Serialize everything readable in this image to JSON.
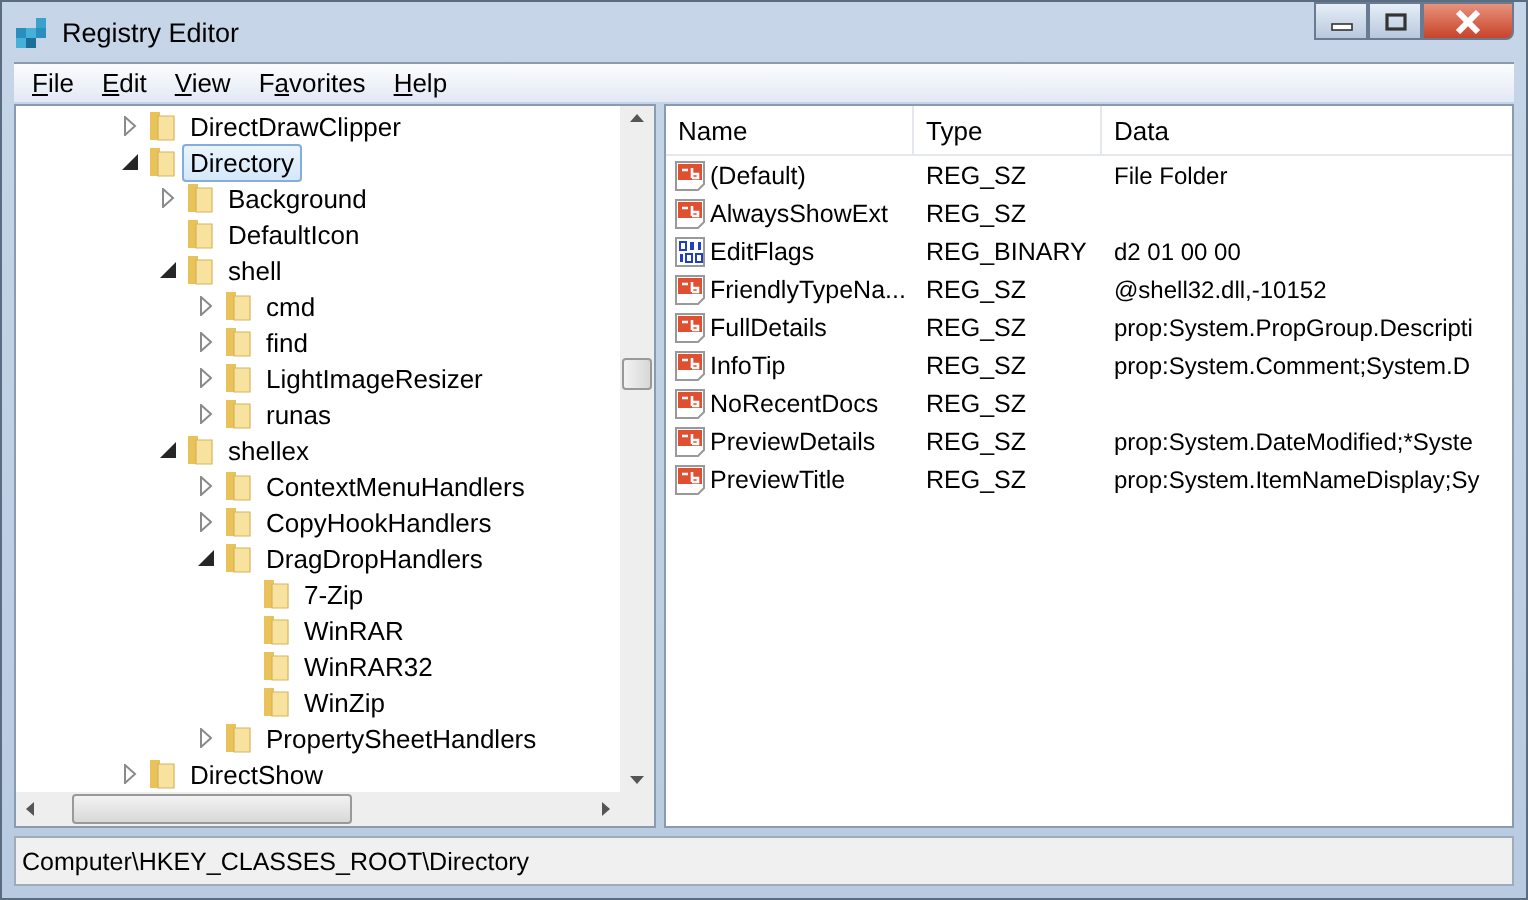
{
  "window": {
    "title": "Registry Editor"
  },
  "menu": [
    "File",
    "Edit",
    "View",
    "Favorites",
    "Help"
  ],
  "tree": [
    {
      "label": "DirectDrawClipper",
      "expanded": false,
      "selected": false
    },
    {
      "label": "Directory",
      "expanded": true,
      "selected": true,
      "children": [
        {
          "label": "Background",
          "expanded": false,
          "selected": false
        },
        {
          "label": "DefaultIcon",
          "selected": false
        },
        {
          "label": "shell",
          "expanded": true,
          "selected": false,
          "children": [
            {
              "label": "cmd",
              "expanded": false,
              "selected": false
            },
            {
              "label": "find",
              "expanded": false,
              "selected": false
            },
            {
              "label": "LightImageResizer",
              "expanded": false,
              "selected": false
            },
            {
              "label": "runas",
              "expanded": false,
              "selected": false
            }
          ]
        },
        {
          "label": "shellex",
          "expanded": true,
          "selected": false,
          "children": [
            {
              "label": "ContextMenuHandlers",
              "expanded": false,
              "selected": false
            },
            {
              "label": "CopyHookHandlers",
              "expanded": false,
              "selected": false
            },
            {
              "label": "DragDropHandlers",
              "expanded": true,
              "selected": false,
              "children": [
                {
                  "label": "7-Zip",
                  "selected": false
                },
                {
                  "label": "WinRAR",
                  "selected": false
                },
                {
                  "label": "WinRAR32",
                  "selected": false
                },
                {
                  "label": "WinZip",
                  "selected": false
                }
              ]
            },
            {
              "label": "PropertySheetHandlers",
              "expanded": false,
              "selected": false
            }
          ]
        }
      ]
    },
    {
      "label": "DirectShow",
      "expanded": false,
      "selected": false
    }
  ],
  "table": {
    "columns": [
      "Name",
      "Type",
      "Data"
    ],
    "rows": [
      {
        "kind": "string",
        "name": "(Default)",
        "type": "REG_SZ",
        "data": "File Folder"
      },
      {
        "kind": "string",
        "name": "AlwaysShowExt",
        "type": "REG_SZ"
      },
      {
        "kind": "binary",
        "name": "EditFlags",
        "type": "REG_BINARY",
        "data": "d2 01 00 00"
      },
      {
        "kind": "string",
        "name": "FriendlyTypeNa...",
        "type": "REG_SZ",
        "data": "@shell32.dll,-10152"
      },
      {
        "kind": "string",
        "name": "FullDetails",
        "type": "REG_SZ",
        "data": "prop:System.PropGroup.Descripti"
      },
      {
        "kind": "string",
        "name": "InfoTip",
        "type": "REG_SZ",
        "data": "prop:System.Comment;System.D"
      },
      {
        "kind": "string",
        "name": "NoRecentDocs",
        "type": "REG_SZ"
      },
      {
        "kind": "string",
        "name": "PreviewDetails",
        "type": "REG_SZ",
        "data": "prop:System.DateModified;*Syste"
      },
      {
        "kind": "string",
        "name": "PreviewTitle",
        "type": "REG_SZ",
        "data": "prop:System.ItemNameDisplay;Sy"
      }
    ]
  },
  "status_bar": "Computer\\HKEY_CLASSES_ROOT\\Directory"
}
